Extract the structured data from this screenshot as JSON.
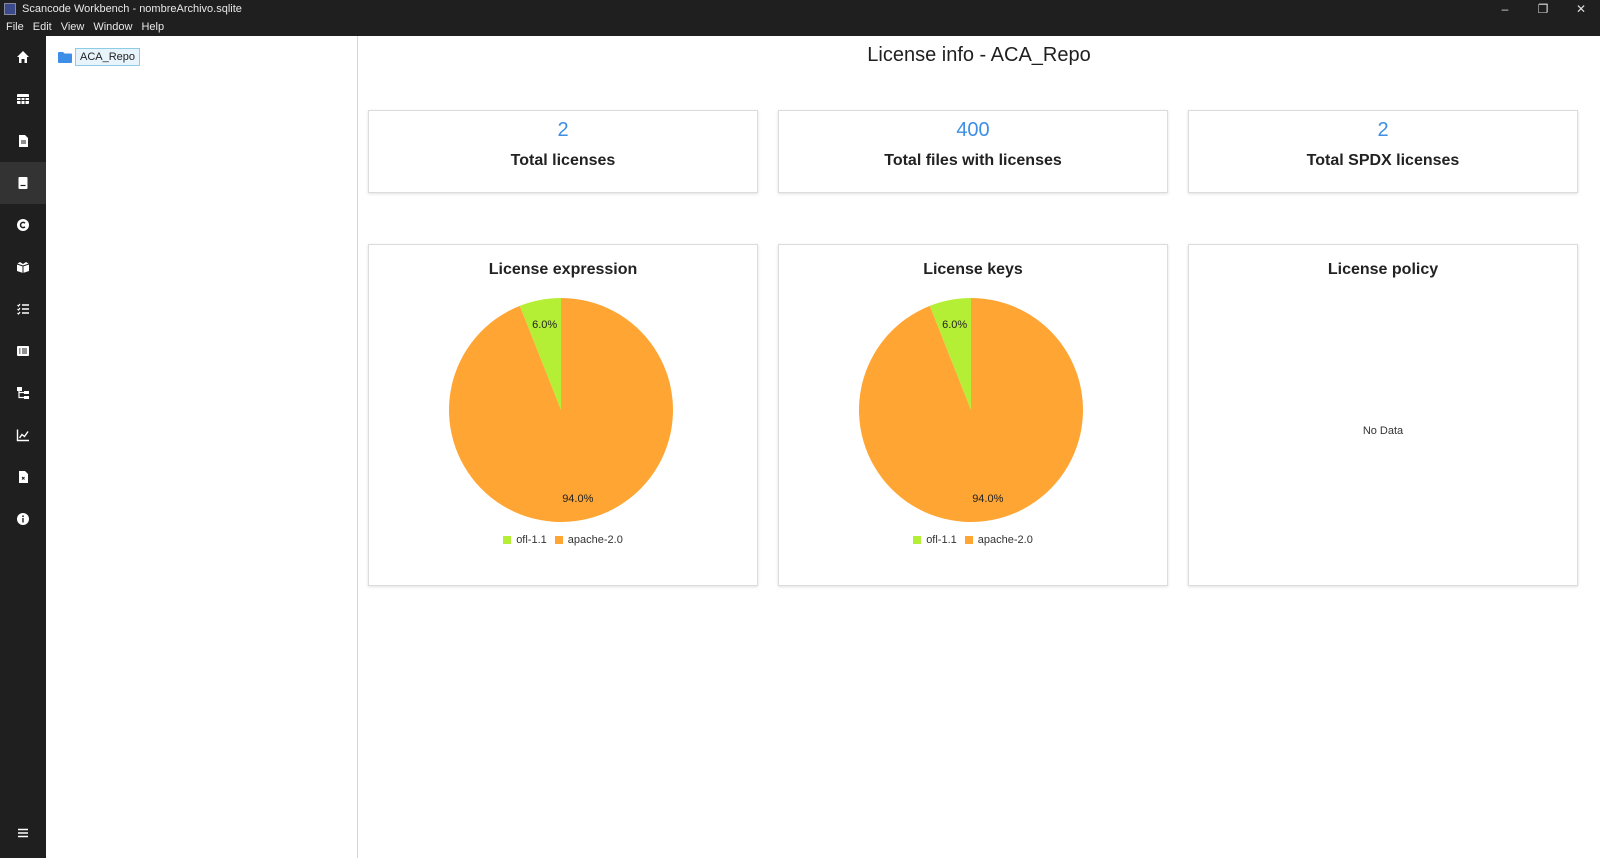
{
  "window": {
    "title": "Scancode Workbench - nombreArchivo.sqlite",
    "controls": [
      "minimize-icon",
      "restore-icon",
      "close-icon"
    ]
  },
  "menu": {
    "items": [
      "File",
      "Edit",
      "View",
      "Window",
      "Help"
    ]
  },
  "sidebar": {
    "icons": [
      "home-icon",
      "table-icon",
      "file-icon",
      "license-icon",
      "copyright-icon",
      "package-icon",
      "list-icon",
      "grid-icon",
      "tree-icon",
      "chart-icon",
      "report-icon",
      "info-icon"
    ],
    "active_index": 3,
    "bottom_icon": "menu-icon"
  },
  "tree": {
    "root_label": "ACA_Repo"
  },
  "main": {
    "title": "License info - ACA_Repo",
    "stats": [
      {
        "value": "2",
        "label": "Total licenses"
      },
      {
        "value": "400",
        "label": "Total files with licenses"
      },
      {
        "value": "2",
        "label": "Total SPDX licenses"
      }
    ],
    "cards": [
      {
        "title": "License expression"
      },
      {
        "title": "License keys"
      },
      {
        "title": "License policy",
        "empty_text": "No Data"
      }
    ]
  },
  "colors": {
    "accent": "#3d8ee6",
    "ofl": "#b5ef35",
    "apache": "#ffa533"
  },
  "chart_data": [
    {
      "type": "pie",
      "title": "License expression",
      "labels": [
        "ofl-1.1",
        "apache-2.0"
      ],
      "values": [
        6.0,
        94.0
      ],
      "value_labels": [
        "6.0%",
        "94.0%"
      ],
      "colors": [
        "#b5ef35",
        "#ffa533"
      ],
      "legend": "bottom"
    },
    {
      "type": "pie",
      "title": "License keys",
      "labels": [
        "ofl-1.1",
        "apache-2.0"
      ],
      "values": [
        6.0,
        94.0
      ],
      "value_labels": [
        "6.0%",
        "94.0%"
      ],
      "colors": [
        "#b5ef35",
        "#ffa533"
      ],
      "legend": "bottom"
    }
  ]
}
